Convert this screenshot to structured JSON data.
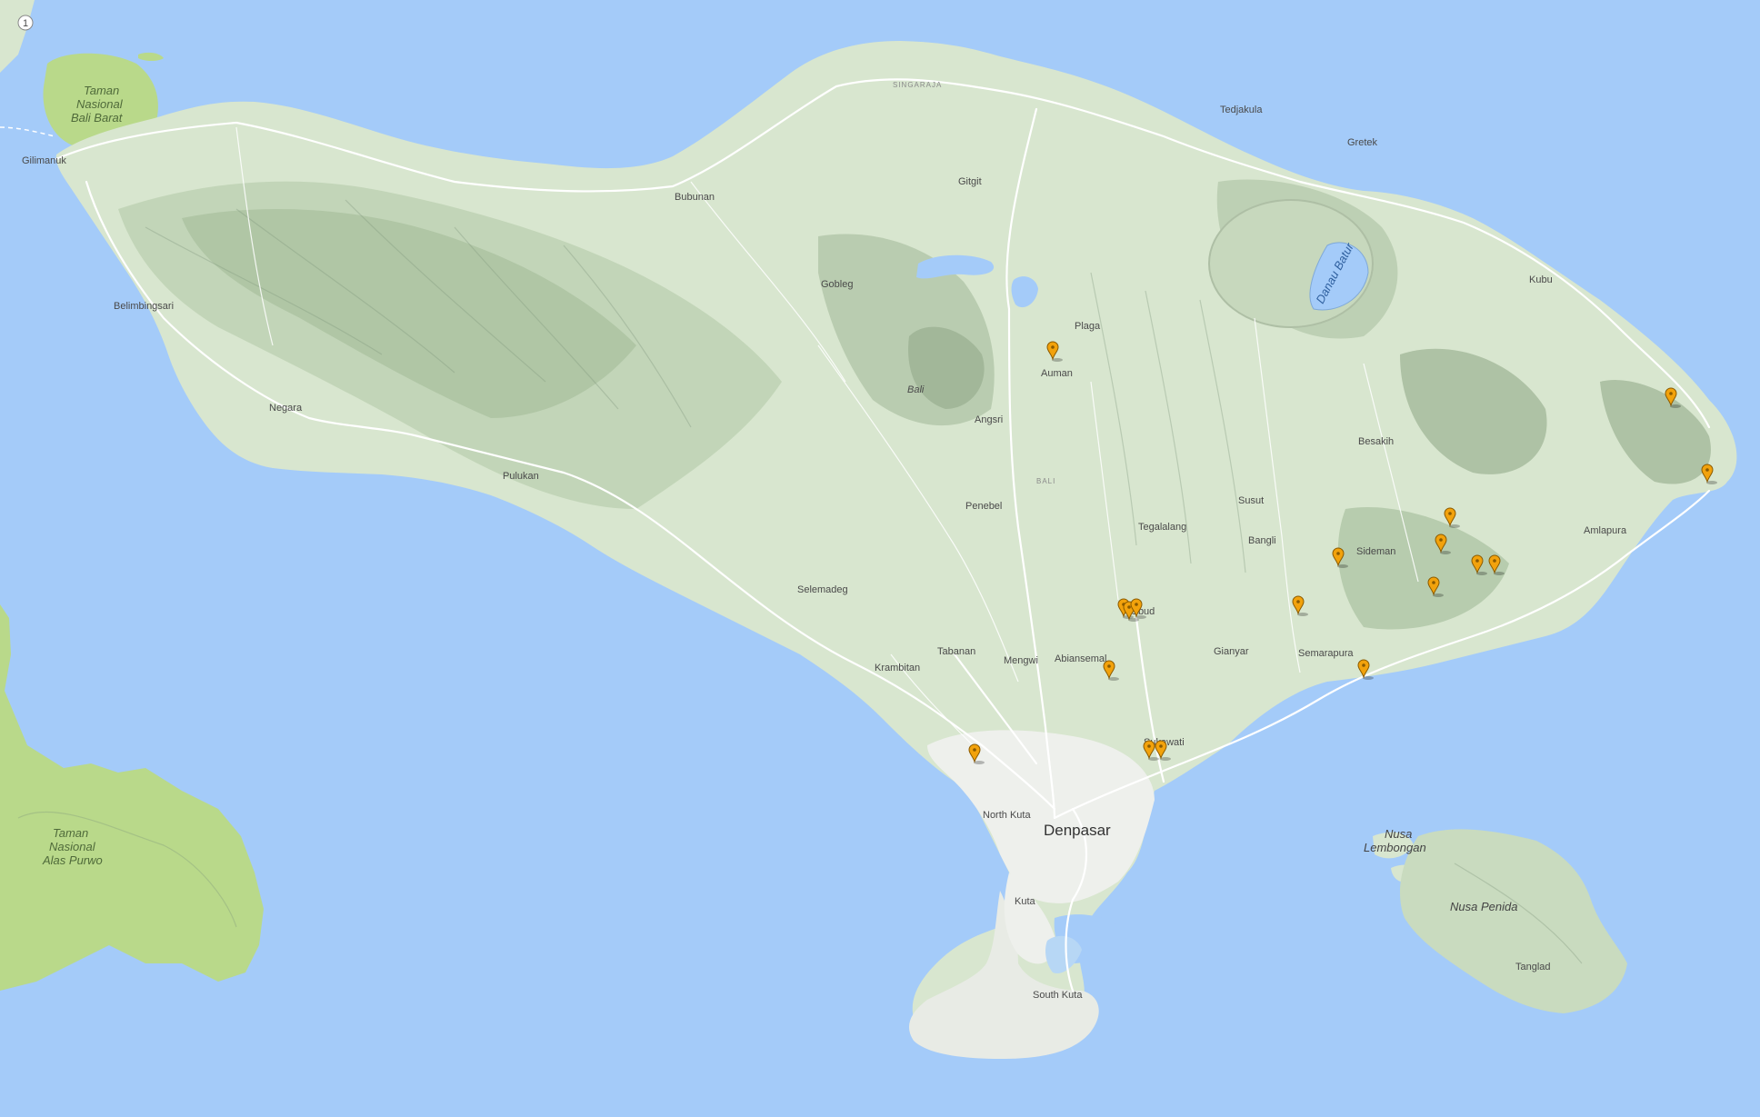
{
  "colors": {
    "sea": "#a4cbf9",
    "land": "#d8e6cf",
    "land_shade": "#c3d6b8",
    "mountain": "#9cb293",
    "park": "#b9d98a",
    "urban": "#eef0ec",
    "lake": "#a4cbf9",
    "marker": "#f2a20c",
    "marker_stroke": "#8a5a00"
  },
  "labels": {
    "park_west": [
      "Taman",
      "Nasional",
      "Bali Barat"
    ],
    "park_java": [
      "Taman",
      "Nasional",
      "Alas Purwo"
    ],
    "gilimanuk": "Gilimanuk",
    "singaraja": "SINGARAJA",
    "tedjakula": "Tedjakula",
    "gretek": "Gretek",
    "gitgit": "Gitgit",
    "bubunan": "Bubunan",
    "gobleg": "Gobleg",
    "kubu": "Kubu",
    "danau_batur": "Danau Batur",
    "plaga": "Plaga",
    "auman": "Auman",
    "belimbingsari": "Belimbingsari",
    "bali": "Bali",
    "angsri": "Angsri",
    "negara": "Negara",
    "besakih": "Besakih",
    "bali_small": "BALI",
    "pulukan": "Pulukan",
    "susut": "Susut",
    "amlapura": "Amlapura",
    "penebel": "Penebel",
    "tegalalang": "Tegalalang",
    "bangli": "Bangli",
    "sideman": "Sideman",
    "selemadeg": "Selemadeg",
    "ubud": "Ubud",
    "tabanan": "Tabanan",
    "mengwi": "Mengwi",
    "abiansemal": "Abiansemal",
    "gianyar": "Gianyar",
    "semarapura": "Semarapura",
    "krambitan": "Krambitan",
    "sukawati": "Sukawati",
    "north_kuta": "North Kuta",
    "denpasar": "Denpasar",
    "nusa_lembongan": [
      "Nusa",
      "Lembongan"
    ],
    "nusa_penida": "Nusa Penida",
    "kuta": "Kuta",
    "tanglad": "Tanglad",
    "south_kuta": "South Kuta",
    "route_shield": "1"
  },
  "markers": [
    {
      "name": "marker-auman"
    },
    {
      "name": "marker-ubud-1"
    },
    {
      "name": "marker-ubud-2"
    },
    {
      "name": "marker-ubud-3"
    },
    {
      "name": "marker-abiansemal"
    },
    {
      "name": "marker-sukawati-1"
    },
    {
      "name": "marker-sukawati-2"
    },
    {
      "name": "marker-canggu"
    },
    {
      "name": "marker-semarapura-north"
    },
    {
      "name": "marker-sideman-west"
    },
    {
      "name": "marker-sideman-north"
    },
    {
      "name": "marker-sideman-1"
    },
    {
      "name": "marker-sideman-2"
    },
    {
      "name": "marker-sideman-3"
    },
    {
      "name": "marker-sideman-4"
    },
    {
      "name": "marker-coast-east"
    },
    {
      "name": "marker-east-peak"
    },
    {
      "name": "marker-east-coast"
    }
  ]
}
